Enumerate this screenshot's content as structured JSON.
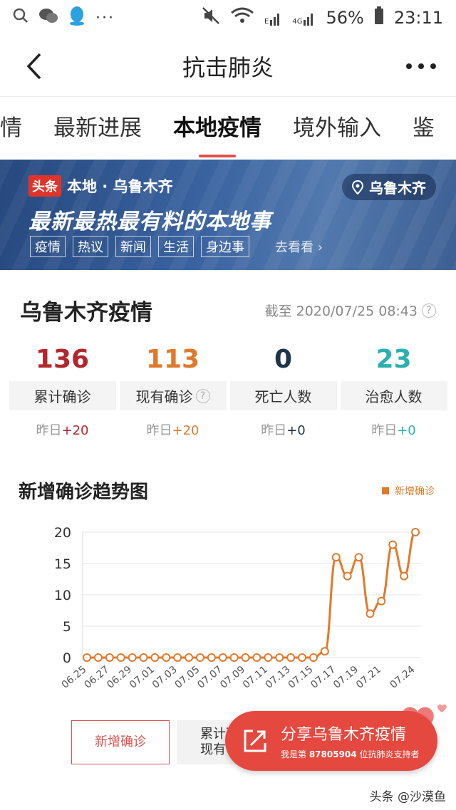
{
  "status_bar": {
    "battery": "56%",
    "time": "23:11",
    "net_e": "E",
    "net_4g": "4G"
  },
  "nav": {
    "title": "抗击肺炎"
  },
  "tabs": [
    "情",
    "最新进展",
    "本地疫情",
    "境外输入",
    "鉴"
  ],
  "active_tab": 2,
  "banner": {
    "badge": "头条",
    "location_line": "本地 · 乌鲁木齐",
    "city": "乌鲁木齐",
    "slogan": "最新最热最有料的本地事",
    "tags": [
      "疫情",
      "热议",
      "新闻",
      "生活",
      "身边事"
    ],
    "more": "去看看 ›"
  },
  "stats": {
    "title": "乌鲁木齐疫情",
    "as_of": "截至 2020/07/25 08:43",
    "items": [
      {
        "value": "136",
        "label": "累计确诊",
        "delta_prefix": "昨日",
        "delta": "+20",
        "color": "#b3262d"
      },
      {
        "value": "113",
        "label": "现有确诊",
        "delta_prefix": "昨日",
        "delta": "+20",
        "color": "#e07a2b"
      },
      {
        "value": "0",
        "label": "死亡人数",
        "delta_prefix": "昨日",
        "delta": "+0",
        "color": "#1e3447"
      },
      {
        "value": "23",
        "label": "治愈人数",
        "delta_prefix": "昨日",
        "delta": "+0",
        "color": "#2bb0b0"
      }
    ]
  },
  "trend": {
    "title": "新增确诊趋势图",
    "legend": "新增确诊"
  },
  "chart_data": {
    "type": "line",
    "title": "新增确诊趋势图",
    "xlabel": "",
    "ylabel": "",
    "ylim": [
      0,
      20
    ],
    "yticks": [
      0,
      5,
      10,
      15,
      20
    ],
    "x": [
      "06.25",
      "06.26",
      "06.27",
      "06.28",
      "06.29",
      "06.30",
      "07.01",
      "07.02",
      "07.03",
      "07.04",
      "07.05",
      "07.06",
      "07.07",
      "07.08",
      "07.09",
      "07.10",
      "07.11",
      "07.12",
      "07.13",
      "07.14",
      "07.15",
      "07.16",
      "07.17",
      "07.18",
      "07.19",
      "07.20",
      "07.21",
      "07.22",
      "07.23",
      "07.24"
    ],
    "xtick_labels": [
      "06.25",
      "06.27",
      "06.29",
      "07.01",
      "07.03",
      "07.05",
      "07.07",
      "07.09",
      "07.11",
      "07.13",
      "07.15",
      "07.17",
      "07.19",
      "07.21",
      "07.24"
    ],
    "series": [
      {
        "name": "新增确诊",
        "color": "#e07a2b",
        "values": [
          0,
          0,
          0,
          0,
          0,
          0,
          0,
          0,
          0,
          0,
          0,
          0,
          0,
          0,
          0,
          0,
          0,
          0,
          0,
          0,
          0,
          1,
          16,
          13,
          16,
          7,
          9,
          18,
          13,
          20
        ]
      }
    ],
    "grid": true,
    "legend_position": "top-right"
  },
  "chart_buttons": {
    "active": "新增确诊",
    "second_line1": "累计确诊",
    "second_line2": "现有"
  },
  "share": {
    "title": "分享乌鲁木齐疫情",
    "sub_prefix": "我是第 ",
    "sub_number": "87805904",
    "sub_suffix": " 位抗肺炎支持者"
  },
  "watermark": "头条 @沙漠鱼"
}
